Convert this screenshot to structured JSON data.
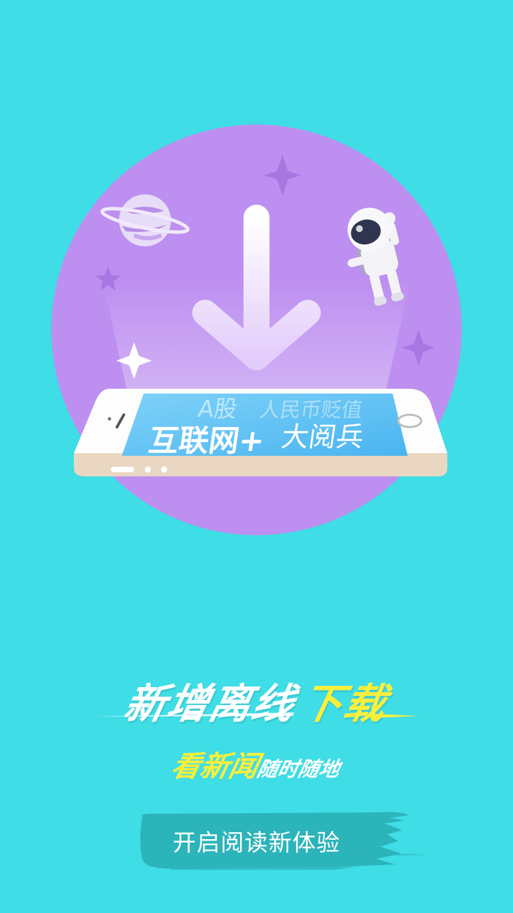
{
  "illustration": {
    "screen_texts": [
      "A股",
      "人民币贬值",
      "互联网+",
      "大阅兵"
    ],
    "colors": {
      "circle": "#bd8ff0",
      "background": "#3fdde6"
    },
    "icons": [
      "download-arrow-icon",
      "planet-icon",
      "astronaut-icon",
      "sparkle-icon",
      "smartphone-icon"
    ]
  },
  "headline": {
    "white_part": "新增离线",
    "yellow_part": "下载"
  },
  "subheadline": {
    "yellow_part": "看新闻",
    "white_part": "随时随地"
  },
  "cta": {
    "label": "开启阅读新体验"
  },
  "colors": {
    "accent_yellow": "#fbef3b",
    "button_brush": "#2cb4bb"
  }
}
